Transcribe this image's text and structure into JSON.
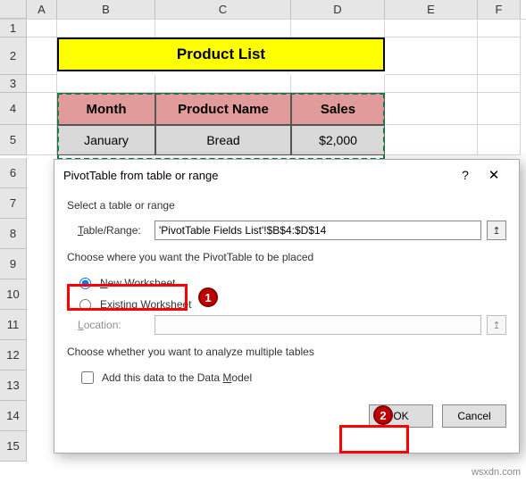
{
  "columns": [
    "A",
    "B",
    "C",
    "D",
    "E",
    "F"
  ],
  "rows_left": [
    "6",
    "7",
    "8",
    "9",
    "10",
    "11",
    "12",
    "13",
    "14",
    "15"
  ],
  "title_cell": "Product List",
  "table": {
    "headers": [
      "Month",
      "Product Name",
      "Sales"
    ],
    "row1": [
      "January",
      "Bread",
      "$2,000"
    ]
  },
  "dialog": {
    "title": "PivotTable from table or range",
    "help": "?",
    "close": "✕",
    "section_select": "Select a table or range",
    "table_range_label": "Table/Range:",
    "table_range_value": "'PivotTable Fields List'!$B$4:$D$14",
    "range_icon": "↥",
    "section_place": "Choose where you want the PivotTable to be placed",
    "radio_new": "New Worksheet",
    "radio_existing": "Existing Worksheet",
    "location_label": "Location:",
    "location_value": "",
    "section_multi": "Choose whether you want to analyze multiple tables",
    "checkbox_label": "Add this data to the Data Model",
    "ok": "OK",
    "cancel": "Cancel"
  },
  "badges": {
    "one": "1",
    "two": "2"
  },
  "watermark": "wsxdn.com",
  "row_labels": {
    "r1": "1",
    "r2": "2",
    "r3": "3",
    "r4": "4",
    "r5": "5"
  }
}
